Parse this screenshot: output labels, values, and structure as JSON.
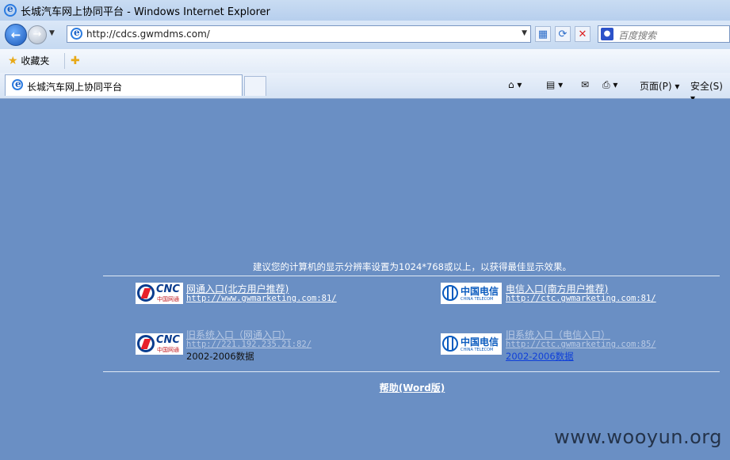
{
  "window": {
    "title": "长城汽车网上协同平台 - Windows Internet Explorer"
  },
  "navigation": {
    "address": "http://cdcs.gwmdms.com/",
    "search_placeholder": "百度搜索",
    "icons": [
      "back-icon",
      "forward-icon",
      "compat-icon",
      "refresh-icon",
      "stop-icon"
    ]
  },
  "favorites_bar": {
    "favorites_label": "收藏夹"
  },
  "tabs": [
    {
      "label": "长城汽车网上协同平台"
    }
  ],
  "command_bar": {
    "page_label": "页面(P)",
    "safety_label": "安全(S)"
  },
  "page": {
    "notice": "建议您的计算机的显示分辨率设置为1024*768或以上，以获得最佳显示效果。",
    "entries": [
      {
        "logo": "CNC",
        "logo_sub": "中国网通",
        "title": "网通入口(北方用户推荐)",
        "url": "http://www.gwmarketing.com:81/"
      },
      {
        "logo": "中国电信",
        "logo_sub": "CHINA TELECOM",
        "title": "电信入口(南方用户推荐)",
        "url": "http://ctc.gwmarketing.com:81/"
      },
      {
        "logo": "CNC",
        "logo_sub": "中国网通",
        "title": "旧系统入口（网通入口）",
        "url": "http://221.192.235.21:82/",
        "note": "2002-2006数据"
      },
      {
        "logo": "中国电信",
        "logo_sub": "CHINA TELECOM",
        "title": "旧系统入口（电信入口）",
        "url": "http://ctc.gwmarketing.com:85/",
        "note": "2002-2006数据"
      }
    ],
    "help_link": "帮助(Word版)"
  },
  "watermark": "www.wooyun.org"
}
